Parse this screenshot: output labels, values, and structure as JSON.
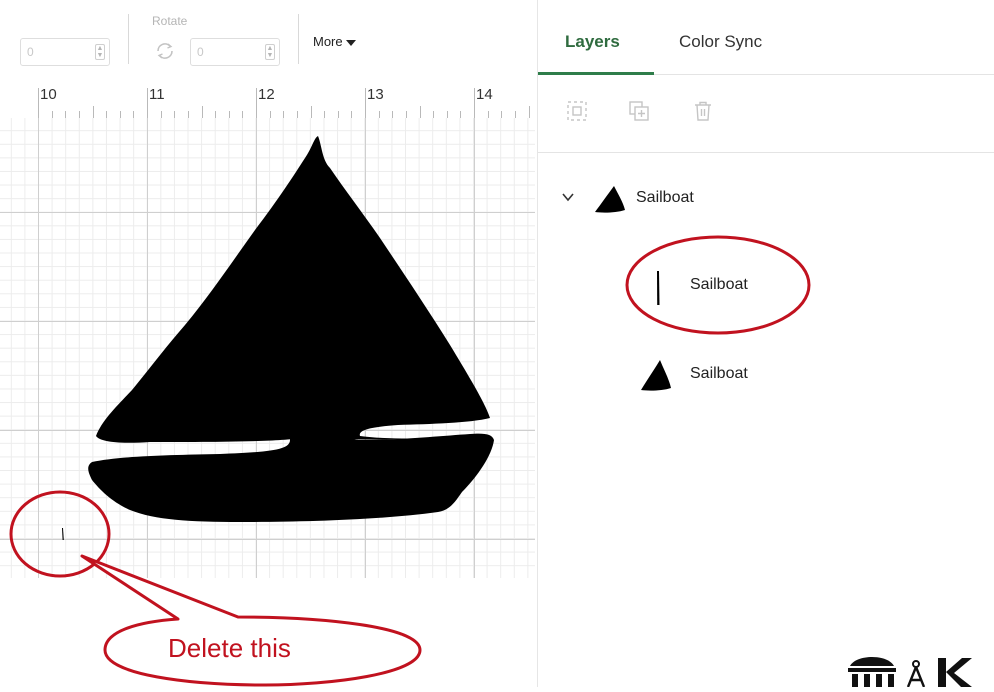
{
  "toolbar": {
    "rotate_label": "Rotate",
    "position_value": "0",
    "rotate_value": "0",
    "more_label": "More"
  },
  "ruler": {
    "numbers": [
      "10",
      "11",
      "12",
      "13",
      "14"
    ]
  },
  "annotation": {
    "callout_text": "Delete this",
    "color": "#c1121f"
  },
  "panel": {
    "tabs": [
      {
        "label": "Layers",
        "active": true
      },
      {
        "label": "Color Sync",
        "active": false
      }
    ],
    "tools": [
      "group-icon",
      "duplicate-icon",
      "delete-icon"
    ],
    "layers": {
      "group_name": "Sailboat",
      "children": [
        {
          "name": "Sailboat",
          "icon": "line-sliver-icon"
        },
        {
          "name": "Sailboat",
          "icon": "sail-triangle-icon"
        }
      ]
    },
    "accent_color": "#2f7d4a"
  }
}
